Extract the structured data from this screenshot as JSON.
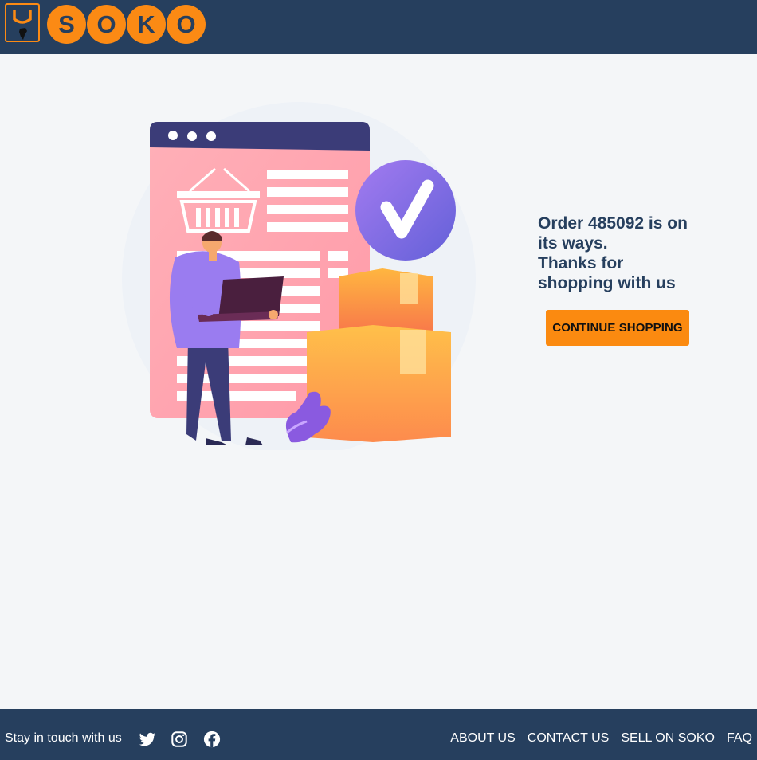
{
  "header": {
    "logo_letters": [
      "S",
      "O",
      "K",
      "O"
    ],
    "colors": {
      "background": "#263f5e",
      "accent": "#fb8a14"
    }
  },
  "main": {
    "message_lines": [
      "Order 485092 is on",
      "its ways.",
      "Thanks for",
      "shopping with us"
    ],
    "continue_button": "CONTINUE SHOPPING",
    "illustration": "order-confirmed-illustration"
  },
  "footer": {
    "stay_in_touch": "Stay in touch with us",
    "social_icons": [
      "twitter-icon",
      "instagram-icon",
      "facebook-icon"
    ],
    "links": [
      "ABOUT US",
      "CONTACT US",
      "SELL ON SOKO",
      "FAQ"
    ]
  }
}
